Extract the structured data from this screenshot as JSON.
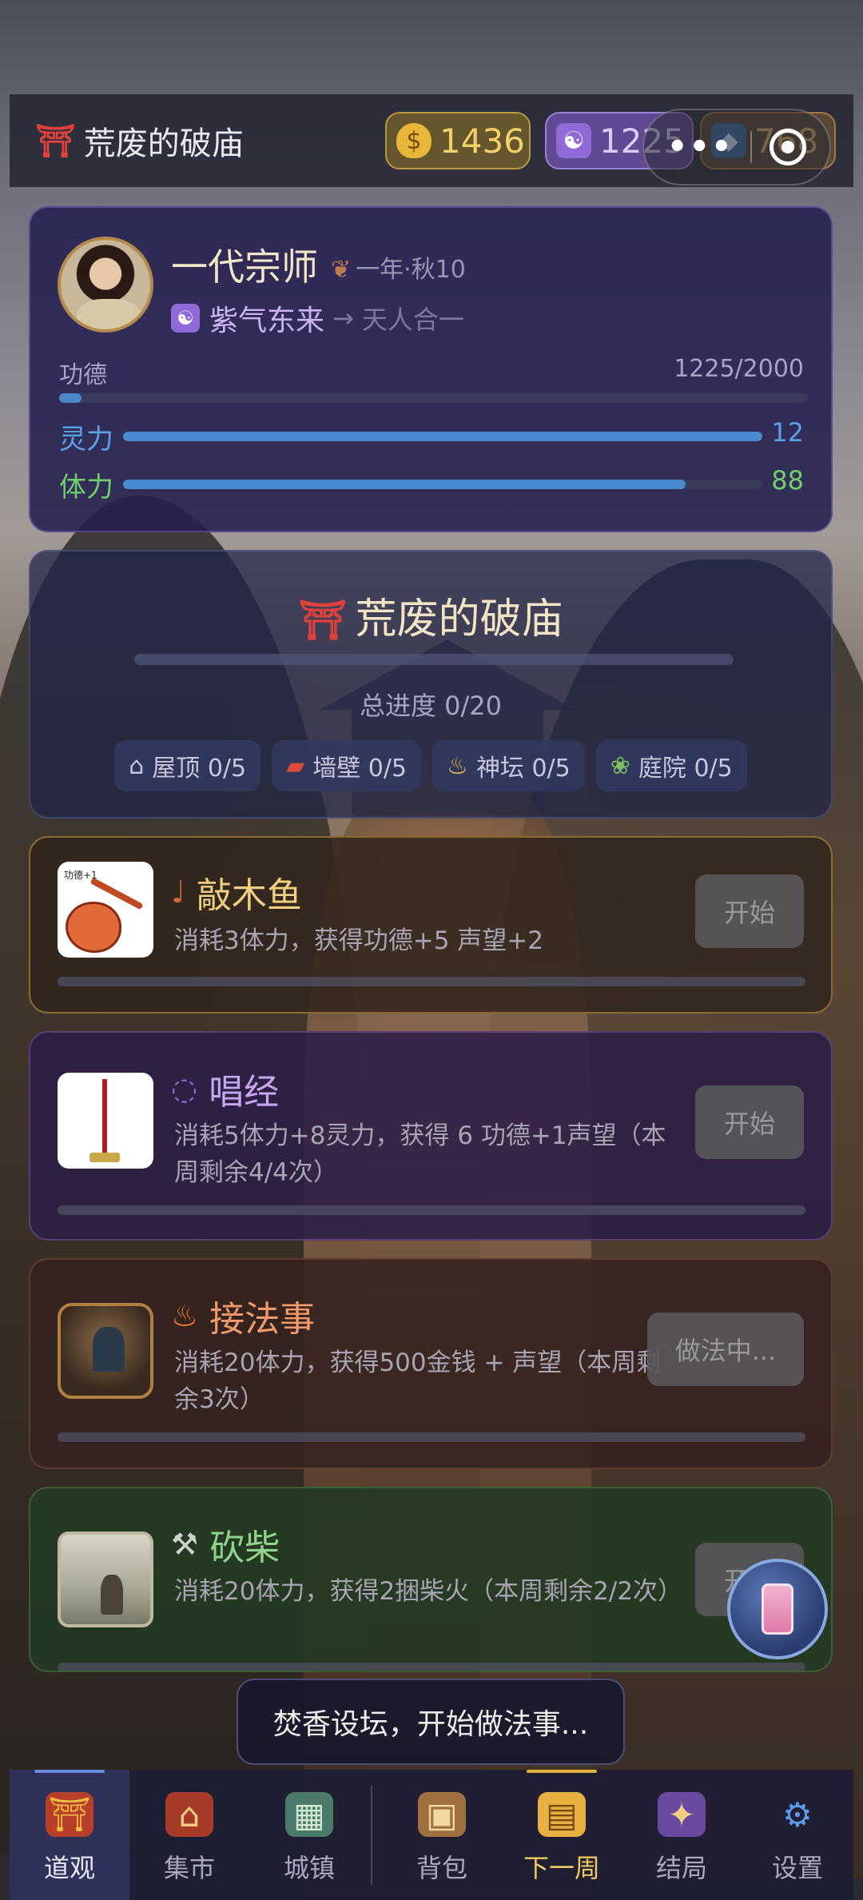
{
  "header": {
    "title": "荒废的破庙",
    "money": "1436",
    "lingqi": "1225",
    "reputation": "768"
  },
  "profile": {
    "name": "一代宗师",
    "season": "一年·秋10",
    "realm": "紫气东来",
    "arrow": "→",
    "next_realm": "天人合一",
    "merit_label": "功德",
    "merit_value": "1225/2000",
    "merit_progress": 0.03,
    "spirit_label": "灵力",
    "spirit_value": "12",
    "spirit_progress": 1.0,
    "stamina_label": "体力",
    "stamina_value": "88",
    "stamina_progress": 0.88
  },
  "temple": {
    "title": "荒废的破庙",
    "progress_text": "总进度 0/20",
    "progress": 0,
    "parts": [
      {
        "icon": "house-icon",
        "label": "屋顶 0/5"
      },
      {
        "icon": "brick-icon",
        "label": "墙壁 0/5"
      },
      {
        "icon": "candle-icon",
        "label": "神坛 0/5"
      },
      {
        "icon": "herb-icon",
        "label": "庭院 0/5"
      }
    ]
  },
  "tasks": [
    {
      "title": "敲木鱼",
      "desc": "消耗3体力，获得功德+5 声望+2",
      "button": "开始",
      "thumb_text": "功德+1",
      "color": "#f0d080"
    },
    {
      "title": "唱经",
      "desc": "消耗5体力+8灵力，获得 6 功德+1声望（本周剩余4/4次）",
      "button": "开始",
      "color": "#c4a8ee"
    },
    {
      "title": "接法事",
      "desc": "消耗20体力，获得500金钱 + 声望（本周剩余3次）",
      "button": "做法中...",
      "color": "#f09a6a"
    },
    {
      "title": "砍柴",
      "desc": "消耗20体力，获得2捆柴火（本周剩余2/2次）",
      "button": "开始",
      "color": "#8ed48a"
    }
  ],
  "toast": "焚香设坛，开始做法事...",
  "nav": [
    {
      "label": "道观",
      "icon": "temple-icon",
      "active": true
    },
    {
      "label": "集市",
      "icon": "market-icon"
    },
    {
      "label": "城镇",
      "icon": "town-icon"
    },
    {
      "label": "背包",
      "icon": "backpack-icon"
    },
    {
      "label": "下一周",
      "icon": "calendar-icon",
      "highlight": true
    },
    {
      "label": "结局",
      "icon": "scroll-icon"
    },
    {
      "label": "设置",
      "icon": "gear-icon"
    }
  ],
  "colors": {
    "accent_gold": "#f3d06a",
    "accent_purple": "#c9b4f0",
    "spirit": "#5aa0e8",
    "stamina": "#6fcf6a",
    "torii_red": "#e0403a"
  }
}
